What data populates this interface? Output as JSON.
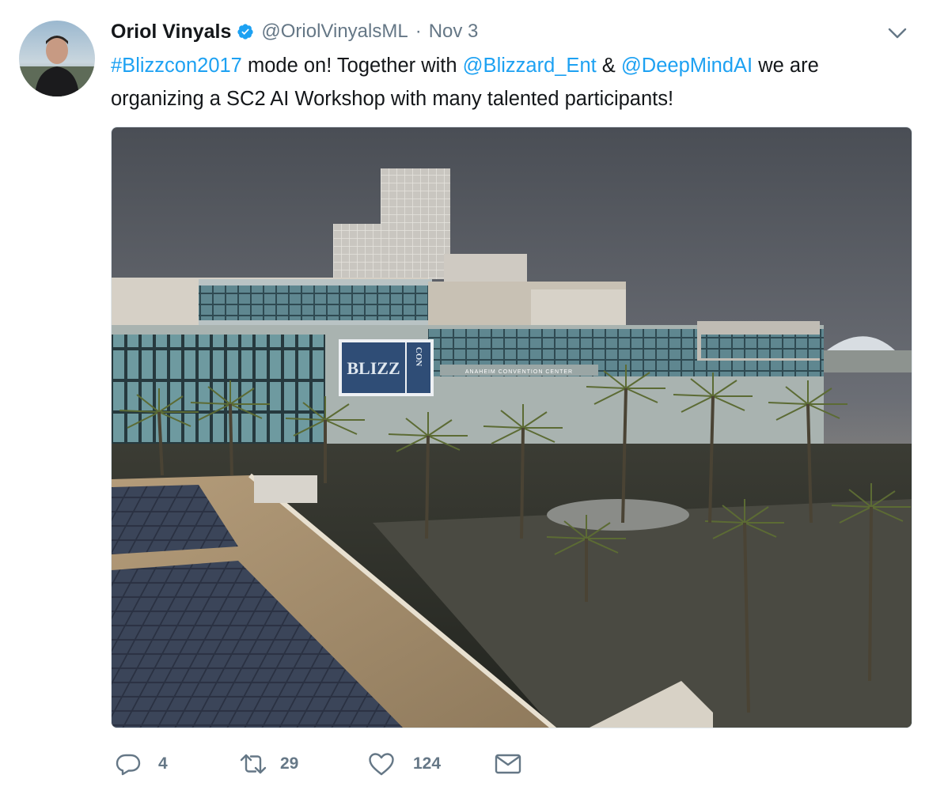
{
  "author": {
    "name": "Oriol Vinyals",
    "handle": "@OriolVinyalsML",
    "separator": "·",
    "timestamp": "Nov 3",
    "verified": true
  },
  "tweet": {
    "segments": {
      "hashtag": "#Blizzcon2017",
      "t1": " mode on! Together with ",
      "mention1": "@Blizzard_Ent",
      "t2": " & ",
      "mention2": "@DeepMindAI",
      "t3": " we are organizing a SC2 AI Workshop with many talented participants!"
    }
  },
  "media": {
    "sign_text_top": "BLIZZ",
    "sign_text_side": "CON",
    "building_text": "ANAHEIM CONVENTION CENTER"
  },
  "actions": {
    "reply_count": "4",
    "retweet_count": "29",
    "like_count": "124"
  },
  "colors": {
    "link": "#1da1f2",
    "verified": "#1da1f2",
    "muted": "#657786",
    "text": "#14171a"
  },
  "icons": [
    "verified-badge-icon",
    "chevron-down-icon",
    "reply-icon",
    "retweet-icon",
    "like-icon",
    "direct-message-icon"
  ]
}
